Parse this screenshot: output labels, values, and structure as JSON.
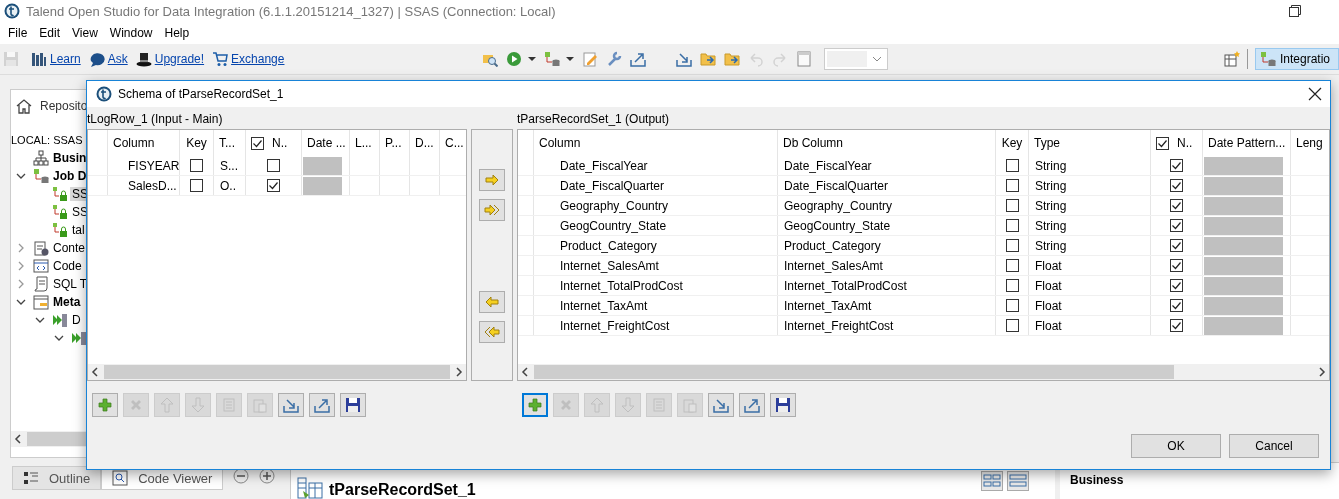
{
  "window": {
    "title": "Talend Open Studio for Data Integration (6.1.1.20151214_1327) | SSAS (Connection: Local)"
  },
  "menu": [
    "File",
    "Edit",
    "View",
    "Window",
    "Help"
  ],
  "toolbar": {
    "save": {
      "disabled": true
    },
    "links": [
      {
        "kind": "learn",
        "label": "Learn"
      },
      {
        "kind": "ask",
        "label": "Ask"
      },
      {
        "kind": "upgrade",
        "label": "Upgrade!"
      },
      {
        "kind": "exchange",
        "label": "Exchange"
      }
    ],
    "tools": [
      {
        "kind": "find",
        "disabled": false
      },
      {
        "kind": "run",
        "disabled": false
      },
      {
        "kind": "dropdown",
        "disabled": false
      },
      {
        "kind": "job",
        "disabled": false
      },
      {
        "kind": "dropdown",
        "disabled": false
      },
      {
        "kind": "edit",
        "disabled": false
      },
      {
        "kind": "wrench",
        "disabled": false
      },
      {
        "kind": "export",
        "disabled": false
      },
      {
        "kind": "import",
        "disabled": false
      },
      {
        "kind": "folder-in",
        "disabled": false
      },
      {
        "kind": "folder-out",
        "disabled": false
      },
      {
        "kind": "undo",
        "disabled": true
      },
      {
        "kind": "redo",
        "disabled": true
      },
      {
        "kind": "page",
        "disabled": false
      }
    ],
    "combo": {
      "disabled": true
    },
    "perspective": {
      "label": "Integratio",
      "selected": true
    }
  },
  "repository": {
    "tab": "Reposito",
    "root": "LOCAL: SSAS",
    "tree": [
      {
        "kind": "diagram",
        "label": "Busin",
        "bold": true,
        "selected": false
      },
      {
        "kind": "job",
        "label": "Job D",
        "bold": true,
        "expanded": true,
        "selected": false,
        "children": [
          {
            "kind": "job-item",
            "label": "SS",
            "bold": false,
            "selected": true
          },
          {
            "kind": "job-item",
            "label": "SS",
            "bold": false,
            "selected": false
          },
          {
            "kind": "job-item",
            "label": "tal",
            "bold": false,
            "selected": false
          }
        ]
      },
      {
        "kind": "context",
        "label": "Conte",
        "bold": false,
        "expanded": false,
        "selected": false
      },
      {
        "kind": "code",
        "label": "Code",
        "bold": false,
        "expanded": false,
        "selected": false
      },
      {
        "kind": "sql",
        "label": "SQL T",
        "bold": false,
        "expanded": false,
        "selected": false
      },
      {
        "kind": "metadata",
        "label": "Meta",
        "bold": true,
        "expanded": true,
        "selected": false,
        "children": [
          {
            "kind": "db",
            "label": "D",
            "bold": false,
            "expanded": true,
            "selected": false,
            "children": [
              {
                "kind": "db",
                "expanded": true
              }
            ]
          }
        ]
      }
    ]
  },
  "bottom_tabs": [
    {
      "kind": "outline",
      "label": "Outline",
      "selected": false
    },
    {
      "kind": "code-viewer",
      "label": "Code Viewer",
      "selected": true
    }
  ],
  "editor": {
    "tab": "tParseRecordSet_1"
  },
  "right_panel": {
    "heading": "Business"
  },
  "dialog": {
    "title": "Schema of tParseRecordSet_1",
    "input": {
      "label": "tLogRow_1 (Input - Main)",
      "columns": [
        "Column",
        "Key",
        "T...",
        "N..",
        "Date ...",
        "L...",
        "P...",
        "D...",
        "C..."
      ],
      "all_nullable": true,
      "rows": [
        {
          "column": "FISYEAR",
          "key": false,
          "type": "S...",
          "nullable": false
        },
        {
          "column": "SalesD...",
          "key": false,
          "type": "O..",
          "nullable": true
        }
      ],
      "tools": [
        {
          "kind": "add",
          "disabled": false,
          "focused": false
        },
        {
          "kind": "remove",
          "disabled": true,
          "focused": false
        },
        {
          "kind": "up",
          "disabled": true,
          "focused": false
        },
        {
          "kind": "down",
          "disabled": true,
          "focused": false
        },
        {
          "kind": "copy",
          "disabled": true,
          "focused": false
        },
        {
          "kind": "paste",
          "disabled": true,
          "focused": false
        },
        {
          "kind": "import",
          "disabled": false,
          "focused": false
        },
        {
          "kind": "export",
          "disabled": false,
          "focused": false
        },
        {
          "kind": "save",
          "disabled": false,
          "focused": false
        }
      ]
    },
    "transfer": [
      {
        "kind": "copy-right"
      },
      {
        "kind": "copy-all-right"
      },
      {
        "kind": "copy-left"
      },
      {
        "kind": "copy-all-left"
      }
    ],
    "output": {
      "label": "tParseRecordSet_1 (Output)",
      "columns": [
        "Column",
        "Db Column",
        "Key",
        "Type",
        "N..",
        "Date Pattern...",
        "Leng"
      ],
      "all_nullable": true,
      "rows": [
        {
          "column": "Date_FiscalYear",
          "db_column": "Date_FiscalYear",
          "key": false,
          "type": "String",
          "nullable": true
        },
        {
          "column": "Date_FiscalQuarter",
          "db_column": "Date_FiscalQuarter",
          "key": false,
          "type": "String",
          "nullable": true
        },
        {
          "column": "Geography_Country",
          "db_column": "Geography_Country",
          "key": false,
          "type": "String",
          "nullable": true
        },
        {
          "column": "GeogCountry_State",
          "db_column": "GeogCountry_State",
          "key": false,
          "type": "String",
          "nullable": true
        },
        {
          "column": "Product_Category",
          "db_column": "Product_Category",
          "key": false,
          "type": "String",
          "nullable": true
        },
        {
          "column": "Internet_SalesAmt",
          "db_column": "Internet_SalesAmt",
          "key": false,
          "type": "Float",
          "nullable": true
        },
        {
          "column": "Internet_TotalProdCost",
          "db_column": "Internet_TotalProdCost",
          "key": false,
          "type": "Float",
          "nullable": true
        },
        {
          "column": "Internet_TaxAmt",
          "db_column": "Internet_TaxAmt",
          "key": false,
          "type": "Float",
          "nullable": true
        },
        {
          "column": "Internet_FreightCost",
          "db_column": "Internet_FreightCost",
          "key": false,
          "type": "Float",
          "nullable": true
        }
      ],
      "tools": [
        {
          "kind": "add",
          "disabled": false,
          "focused": true
        },
        {
          "kind": "remove",
          "disabled": true,
          "focused": false
        },
        {
          "kind": "up",
          "disabled": true,
          "focused": false
        },
        {
          "kind": "down",
          "disabled": true,
          "focused": false
        },
        {
          "kind": "copy",
          "disabled": true,
          "focused": false
        },
        {
          "kind": "paste",
          "disabled": true,
          "focused": false
        },
        {
          "kind": "import",
          "disabled": false,
          "focused": false
        },
        {
          "kind": "export",
          "disabled": false,
          "focused": false
        },
        {
          "kind": "save",
          "disabled": false,
          "focused": false
        }
      ]
    },
    "buttons": [
      {
        "label": "OK"
      },
      {
        "label": "Cancel"
      }
    ]
  }
}
